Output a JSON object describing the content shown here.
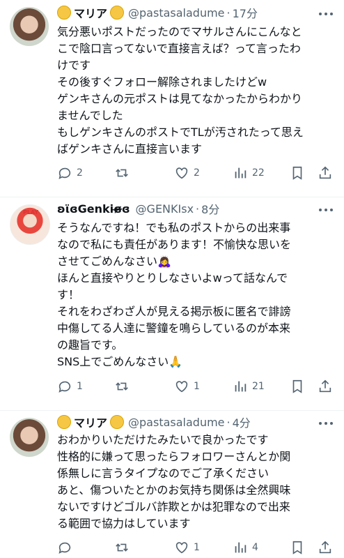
{
  "tweets": [
    {
      "name": "マリア",
      "handle": "@pastasaladume",
      "time": "17分",
      "lines": [
        "気分悪いポストだったのでマサルさんにこんなと",
        "こで陰口言ってないで直接言えば？って言ったわ",
        "けです",
        "その後すぐフォロー解除されましたけどw",
        "ゲンキさんの元ポストは見てなかったからわかり",
        "ませんでした",
        "もしゲンキさんのポストでTLが汚されたって思え",
        "ばゲンキさんに直接言います"
      ],
      "replies": "2",
      "retweets": "",
      "likes": "2",
      "views": "22"
    },
    {
      "name": "ʚϊɞGenkiɞ̴̶̷ɞ",
      "handle": "@GENKIsx",
      "time": "8分",
      "lines": [
        "そうなんですね！でも私のポストからの出来事",
        "なので私にも責任があります！不愉快な思いを",
        "させてごめんなさい🙇‍♀️",
        "ほんと直接やりとりしなさいよwって話なんで",
        "す！",
        "それをわざわざ人が見える掲示板に匿名で誹謗",
        "中傷してる人達に警鐘を鳴らしているのが本来",
        "の趣旨です。",
        "SNS上でごめんなさい🙏"
      ],
      "replies": "1",
      "retweets": "",
      "likes": "1",
      "views": "21"
    },
    {
      "name": "マリア",
      "handle": "@pastasaladume",
      "time": "4分",
      "lines": [
        "おわかりいただけたみたいで良かったです",
        "性格的に嫌って思ったらフォロワーさんとか関",
        "係無しに言うタイプなのでご了承ください",
        "あと、傷ついたとかのお気持ち関係は全然興味",
        "ないですけどゴルバ詐欺とかは犯罪なので出来",
        "る範囲で協力はしています"
      ],
      "replies": "",
      "retweets": "",
      "likes": "1",
      "views": "4"
    }
  ],
  "colors": {
    "text": "#0f1419",
    "muted": "#536471",
    "divider": "#eff3f4"
  },
  "icons": [
    "reply-icon",
    "retweet-icon",
    "like-icon",
    "views-icon",
    "bookmark-icon",
    "share-icon",
    "more-icon"
  ]
}
